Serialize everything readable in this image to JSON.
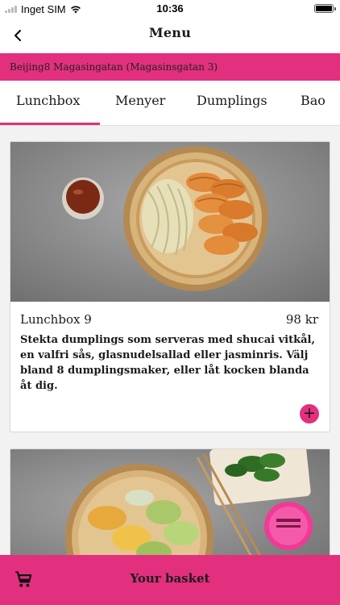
{
  "status_bar": {
    "carrier": "Inget SIM",
    "time": "10:36"
  },
  "nav": {
    "title": "Menu"
  },
  "restaurant": {
    "name": "Beijing8 Magasingatan (Magasinsgatan 3)"
  },
  "tabs": [
    {
      "label": "Lunchbox",
      "active": true
    },
    {
      "label": "Menyer",
      "active": false
    },
    {
      "label": "Dumplings",
      "active": false
    },
    {
      "label": "Bao",
      "active": false
    }
  ],
  "menu_items": [
    {
      "name": "Lunchbox 9",
      "price": "98 kr",
      "description": "Stekta dumplings som serveras med shucai vitkål, en valfri sås, glasnudelsallad eller jasminris. Välj bland 8 dumplingsmaker, eller låt kocken blanda åt dig."
    }
  ],
  "basket": {
    "label": "Your basket"
  },
  "colors": {
    "accent": "#e2307f"
  },
  "icons": {
    "back": "chevron-left-icon",
    "add": "plus-icon",
    "cart": "cart-icon"
  }
}
